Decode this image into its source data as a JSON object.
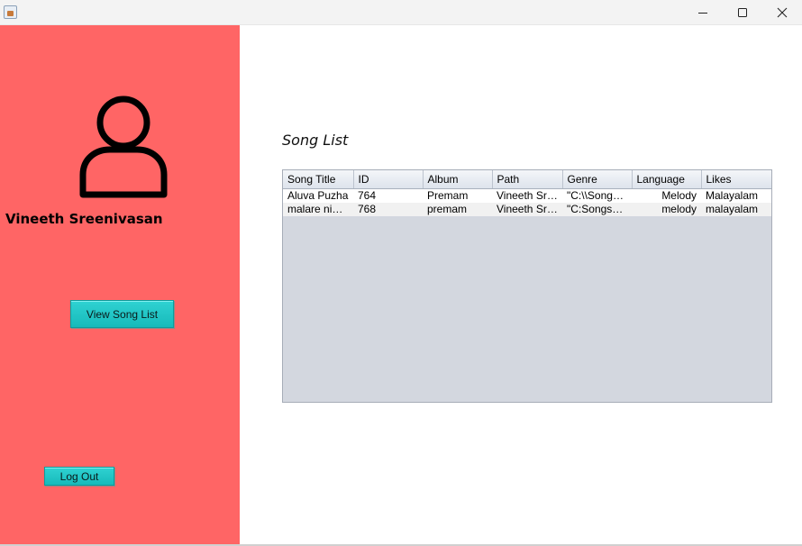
{
  "window": {
    "title": "",
    "controls": {
      "minimize_icon": "minimize-icon",
      "maximize_icon": "maximize-icon",
      "close_icon": "close-icon"
    }
  },
  "sidebar": {
    "background": "#ff6565",
    "avatar_icon": "user-avatar-icon",
    "user_name": "Vineeth Sreenivasan",
    "view_button_label": "View Song List",
    "logout_button_label": "Log Out"
  },
  "main": {
    "section_title": "Song List",
    "table": {
      "columns": [
        "Song Title",
        "ID",
        "Album",
        "Path",
        "Genre",
        "Language",
        "Likes"
      ],
      "rows": [
        [
          "Aluva Puzha",
          "764",
          "Premam",
          "Vineeth Sre...",
          "\"C:\\\\Songs\\\\...",
          "Melody",
          "Malayalam"
        ],
        [
          "malare ninne",
          "768",
          "premam",
          "Vineeth Sre...",
          "\"C:SongsM...",
          "melody",
          "malayalam"
        ]
      ]
    }
  }
}
